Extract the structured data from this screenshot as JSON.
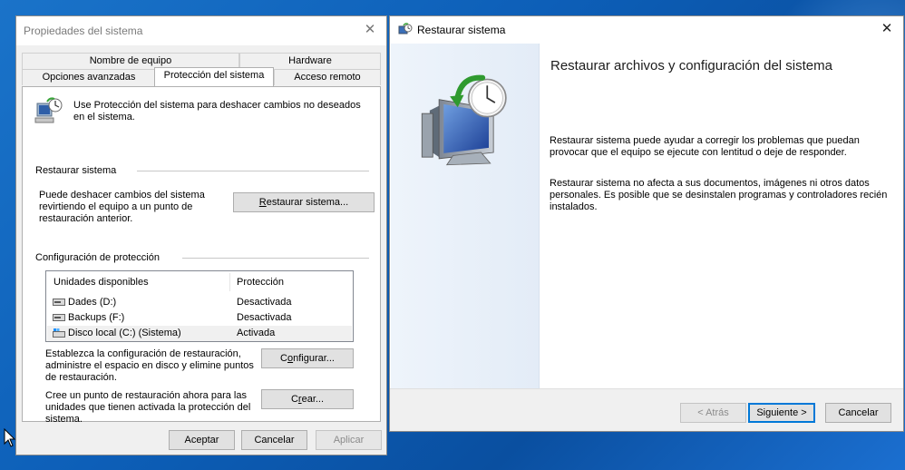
{
  "system_properties": {
    "title": "Propiedades del sistema",
    "tabs_row1": [
      "Nombre de equipo",
      "Hardware"
    ],
    "tabs_row2": [
      "Opciones avanzadas",
      "Protección del sistema",
      "Acceso remoto"
    ],
    "active_tab": "Protección del sistema",
    "intro_text": "Use Protección del sistema para deshacer cambios no deseados en el sistema.",
    "restore_group": {
      "title": "Restaurar sistema",
      "description": "Puede deshacer cambios del sistema revirtiendo el equipo a un punto de restauración anterior.",
      "button_prefix": "R",
      "button_rest": "estaurar sistema..."
    },
    "protection_group": {
      "title": "Configuración de protección",
      "columns": [
        "Unidades disponibles",
        "Protección"
      ],
      "drives": [
        {
          "name": "Dades (D:)",
          "protection": "Desactivada",
          "icon": "hard-drive-icon"
        },
        {
          "name": "Backups (F:)",
          "protection": "Desactivada",
          "icon": "hard-drive-icon"
        },
        {
          "name": "Disco local (C:) (Sistema)",
          "protection": "Activada",
          "icon": "system-drive-icon"
        }
      ],
      "configure_text": "Establezca la configuración de restauración, administre el espacio en disco y elimine puntos de restauración.",
      "configure_pre": "C",
      "configure_ul": "o",
      "configure_post": "nfigurar...",
      "create_text": "Cree un punto de restauración ahora para las unidades que tienen activada la protección del sistema.",
      "create_pre": "C",
      "create_ul": "r",
      "create_post": "ear..."
    },
    "buttons": {
      "ok": "Aceptar",
      "cancel": "Cancelar",
      "apply": "Aplicar"
    }
  },
  "restore_wizard": {
    "title": "Restaurar sistema",
    "heading": "Restaurar archivos y configuración del sistema",
    "paragraph1": "Restaurar sistema puede ayudar a corregir los problemas que puedan provocar que el equipo se ejecute con lentitud o deje de responder.",
    "paragraph2": "Restaurar sistema no afecta a sus documentos, imágenes ni otros datos personales. Es posible que se desinstalen programas y controladores recién instalados.",
    "buttons": {
      "back": "< Atrás",
      "next": "Siguiente >",
      "cancel": "Cancelar"
    }
  },
  "colors": {
    "accent": "#0078d7",
    "desktop": "#0d5fb8"
  }
}
